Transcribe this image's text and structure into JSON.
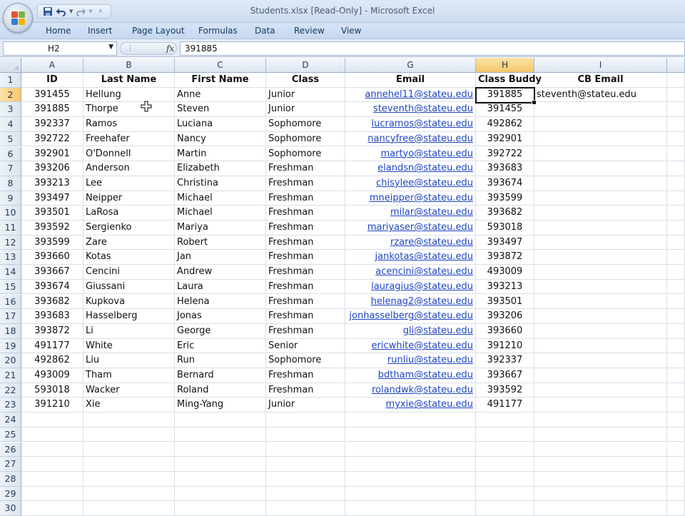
{
  "window": {
    "title": "Students.xlsx  [Read-Only]  -  Microsoft Excel"
  },
  "quick_access": {
    "save_icon": "save-icon",
    "undo_icon": "undo-icon",
    "redo_icon": "redo-icon",
    "customize_icon": "customize-qat-icon"
  },
  "ribbon": {
    "tabs": [
      "Home",
      "Insert",
      "Page Layout",
      "Formulas",
      "Data",
      "Review",
      "View"
    ]
  },
  "formula_bar": {
    "name_box": "H2",
    "fx_label": "fx",
    "formula": "391885"
  },
  "columns": [
    "A",
    "B",
    "C",
    "D",
    "G",
    "H",
    "I"
  ],
  "selected_column": "H",
  "selected_row": 2,
  "headers": {
    "id": "ID",
    "last": "Last Name",
    "first": "First Name",
    "class": "Class",
    "email": "Email",
    "buddy": "Class Buddy",
    "cb_email": "CB Email"
  },
  "rows": [
    {
      "id": "391455",
      "last": "Hellung",
      "first": "Anne",
      "class": "Junior",
      "email": "annehel11@stateu.edu",
      "buddy": "391885",
      "cb_email": "steventh@stateu.edu"
    },
    {
      "id": "391885",
      "last": "Thorpe",
      "first": "Steven",
      "class": "Junior",
      "email": "steventh@stateu.edu",
      "buddy": "391455",
      "cb_email": ""
    },
    {
      "id": "392337",
      "last": "Ramos",
      "first": "Luciana",
      "class": "Sophomore",
      "email": "lucramos@stateu.edu",
      "buddy": "492862",
      "cb_email": ""
    },
    {
      "id": "392722",
      "last": "Freehafer",
      "first": "Nancy",
      "class": "Sophomore",
      "email": "nancyfree@stateu.edu",
      "buddy": "392901",
      "cb_email": ""
    },
    {
      "id": "392901",
      "last": "O'Donnell",
      "first": "Martin",
      "class": "Sophomore",
      "email": "martyo@stateu.edu",
      "buddy": "392722",
      "cb_email": ""
    },
    {
      "id": "393206",
      "last": "Anderson",
      "first": "Elizabeth",
      "class": "Freshman",
      "email": "elandsn@stateu.edu",
      "buddy": "393683",
      "cb_email": ""
    },
    {
      "id": "393213",
      "last": "Lee",
      "first": "Christina",
      "class": "Freshman",
      "email": "chisylee@stateu.edu",
      "buddy": "393674",
      "cb_email": ""
    },
    {
      "id": "393497",
      "last": "Neipper",
      "first": "Michael",
      "class": "Freshman",
      "email": "mneipper@stateu.edu",
      "buddy": "393599",
      "cb_email": ""
    },
    {
      "id": "393501",
      "last": "LaRosa",
      "first": "Michael",
      "class": "Freshman",
      "email": "milar@stateu.edu",
      "buddy": "393682",
      "cb_email": ""
    },
    {
      "id": "393592",
      "last": "Sergienko",
      "first": "Mariya",
      "class": "Freshman",
      "email": "mariyaser@stateu.edu",
      "buddy": "593018",
      "cb_email": ""
    },
    {
      "id": "393599",
      "last": "Zare",
      "first": "Robert",
      "class": "Freshman",
      "email": "rzare@stateu.edu",
      "buddy": "393497",
      "cb_email": ""
    },
    {
      "id": "393660",
      "last": "Kotas",
      "first": "Jan",
      "class": "Freshman",
      "email": "jankotas@stateu.edu",
      "buddy": "393872",
      "cb_email": ""
    },
    {
      "id": "393667",
      "last": "Cencini",
      "first": "Andrew",
      "class": "Freshman",
      "email": "acencini@stateu.edu",
      "buddy": "493009",
      "cb_email": ""
    },
    {
      "id": "393674",
      "last": "Giussani",
      "first": "Laura",
      "class": "Freshman",
      "email": "lauragius@stateu.edu",
      "buddy": "393213",
      "cb_email": ""
    },
    {
      "id": "393682",
      "last": "Kupkova",
      "first": "Helena",
      "class": "Freshman",
      "email": "helenag2@stateu.edu",
      "buddy": "393501",
      "cb_email": ""
    },
    {
      "id": "393683",
      "last": "Hasselberg",
      "first": "Jonas",
      "class": "Freshman",
      "email": "jonhasselberg@stateu.edu",
      "buddy": "393206",
      "cb_email": ""
    },
    {
      "id": "393872",
      "last": "Li",
      "first": "George",
      "class": "Freshman",
      "email": "gli@stateu.edu",
      "buddy": "393660",
      "cb_email": ""
    },
    {
      "id": "491177",
      "last": "White",
      "first": "Eric",
      "class": "Senior",
      "email": "ericwhite@stateu.edu",
      "buddy": "391210",
      "cb_email": ""
    },
    {
      "id": "492862",
      "last": "Liu",
      "first": "Run",
      "class": "Sophomore",
      "email": "runliu@stateu.edu",
      "buddy": "392337",
      "cb_email": ""
    },
    {
      "id": "493009",
      "last": "Tham",
      "first": "Bernard",
      "class": "Freshman",
      "email": "bdtham@stateu.edu",
      "buddy": "393667",
      "cb_email": ""
    },
    {
      "id": "593018",
      "last": "Wacker",
      "first": "Roland",
      "class": "Freshman",
      "email": "rolandwk@stateu.edu",
      "buddy": "393592",
      "cb_email": ""
    },
    {
      "id": "391210",
      "last": "Xie",
      "first": "Ming-Yang",
      "class": "Junior",
      "email": "myxie@stateu.edu",
      "buddy": "491177",
      "cb_email": ""
    }
  ],
  "empty_row_numbers": [
    24,
    25,
    26,
    27,
    28,
    29,
    30
  ],
  "colors": {
    "link": "#1e44c4",
    "selected_header": "#f5c76c",
    "title_bar": "#cddcef"
  }
}
